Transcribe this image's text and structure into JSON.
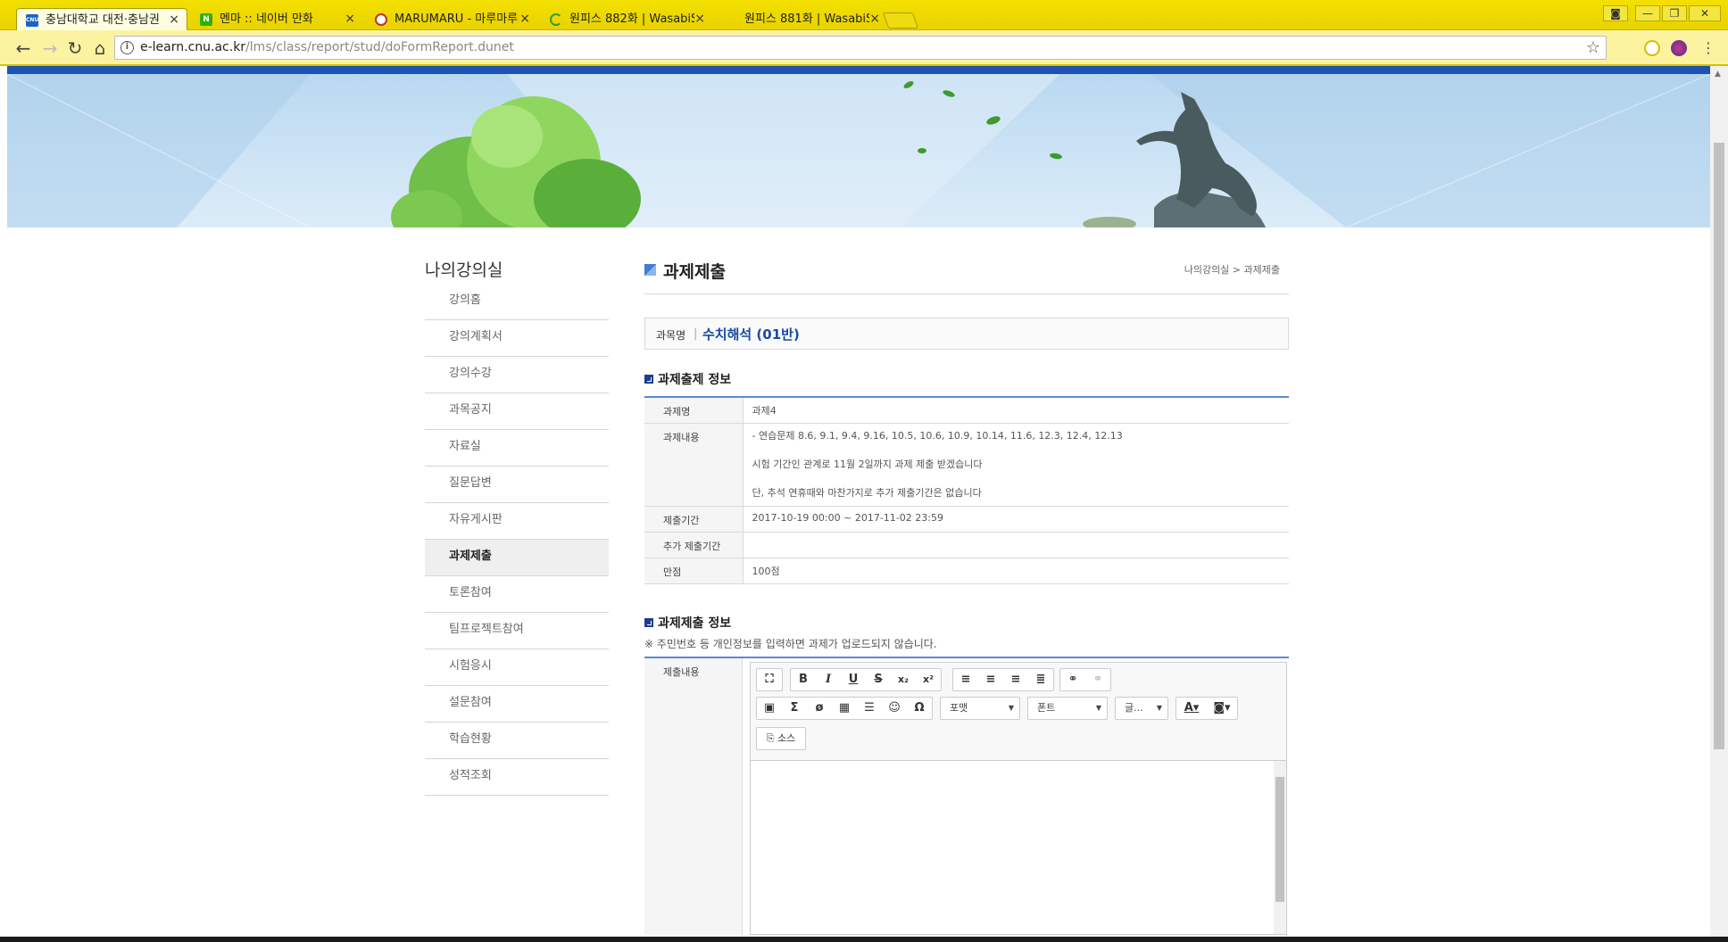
{
  "browser": {
    "tabs": [
      {
        "label": "충남대학교 대전·충남권",
        "favicon": "CNU",
        "color": "#1a64c8",
        "active": true
      },
      {
        "label": "멘마 :: 네이버 만화",
        "favicon": "N",
        "color": "#2db400",
        "active": false
      },
      {
        "label": "MARUMARU - 마루마루",
        "favicon": "eye-icon",
        "color": "#c23030",
        "active": false
      },
      {
        "label": "원피스 882화 | WasabiS",
        "favicon": "spinner-icon",
        "color": "#3a9a3a",
        "active": false
      },
      {
        "label": "원피스 881화 | WasabiS",
        "favicon": "",
        "color": "#999999",
        "active": false
      }
    ],
    "tab_close": "×",
    "url_host": "e-learn.cnu.ac.kr",
    "url_path": "/lms/class/report/stud/doFormReport.dunet"
  },
  "sidebar": {
    "title": "나의강의실",
    "items": [
      {
        "label": "강의홈",
        "active": false
      },
      {
        "label": "강의계획서",
        "active": false
      },
      {
        "label": "강의수강",
        "active": false
      },
      {
        "label": "과목공지",
        "active": false
      },
      {
        "label": "자료실",
        "active": false
      },
      {
        "label": "질문답변",
        "active": false
      },
      {
        "label": "자유게시판",
        "active": false
      },
      {
        "label": "과제제출",
        "active": true
      },
      {
        "label": "토론참여",
        "active": false
      },
      {
        "label": "팀프로젝트참여",
        "active": false
      },
      {
        "label": "시험응시",
        "active": false
      },
      {
        "label": "설문참여",
        "active": false
      },
      {
        "label": "학습현황",
        "active": false
      },
      {
        "label": "성적조회",
        "active": false
      }
    ]
  },
  "main": {
    "title": "과제제출",
    "breadcrumb": "나의강의실 > 과제제출",
    "course_label": "과목명",
    "course_name": "수치해석 (01반)",
    "assignment_section": "과제출제 정보",
    "assignment": {
      "name_label": "과제명",
      "name": "과제4",
      "content_label": "과제내용",
      "content_lines": [
        "- 연습문제 8.6, 9.1, 9.4, 9.16, 10.5, 10.6, 10.9, 10.14, 11.6, 12.3, 12.4, 12.13",
        "시험 기간인 관계로 11월 2일까지 과제 제출 받겠습니다",
        "단, 추석 연휴때와 마찬가지로 추가 제출기간은 없습니다"
      ],
      "period_label": "제출기간",
      "period": "2017-10-19 00:00 ~ 2017-11-02 23:59",
      "extra_label": "추가 제출기간",
      "extra": "",
      "score_label": "만점",
      "score": "100점"
    },
    "submit_section": "과제제출 정보",
    "notice": "※ 주민번호 등 개인정보를 입력하면 과제가 업로드되지 않습니다.",
    "submit_label": "제출내용",
    "editor": {
      "format_combo": "포맷",
      "font_combo": "폰트",
      "size_combo": "글...",
      "source_label": "소스"
    }
  }
}
